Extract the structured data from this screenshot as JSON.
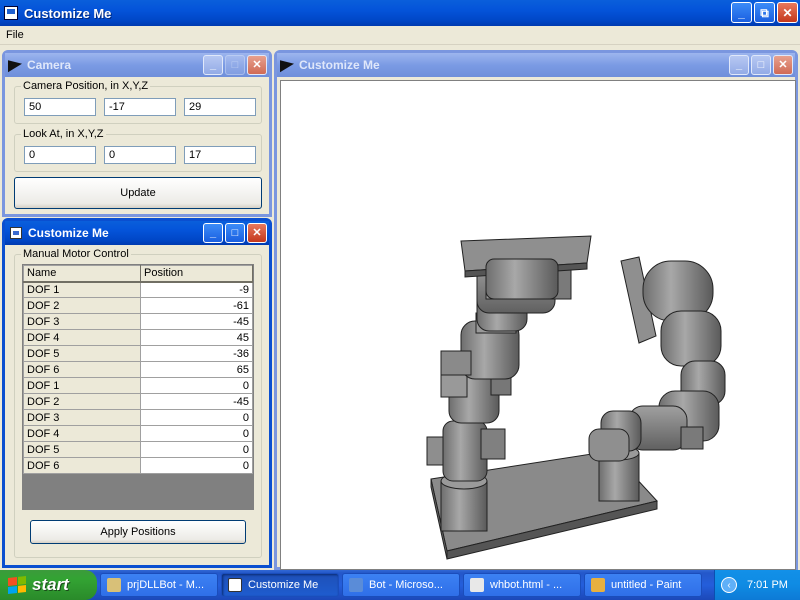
{
  "app": {
    "title": "Customize Me",
    "icon": "app-window-icon"
  },
  "window_buttons": {
    "minimize": "_",
    "maximize": "⧉",
    "close": "✕"
  },
  "menu": {
    "items": [
      "File"
    ]
  },
  "camera_window": {
    "title": "Camera",
    "position_group": {
      "legend": "Camera Position, in X,Y,Z",
      "x": "50",
      "y": "-17",
      "z": "29"
    },
    "look_group": {
      "legend": "Look At, in X,Y,Z",
      "x": "0",
      "y": "0",
      "z": "17"
    },
    "update_label": "Update"
  },
  "motor_window": {
    "title": "Customize Me",
    "group_legend": "Manual Motor Control",
    "columns": [
      "Name",
      "Position"
    ],
    "rows": [
      {
        "name": "DOF 1",
        "position": "-9"
      },
      {
        "name": "DOF 2",
        "position": "-61"
      },
      {
        "name": "DOF 3",
        "position": "-45"
      },
      {
        "name": "DOF 4",
        "position": "45"
      },
      {
        "name": "DOF 5",
        "position": "-36"
      },
      {
        "name": "DOF 6",
        "position": "65"
      },
      {
        "name": "DOF 1",
        "position": "0"
      },
      {
        "name": "DOF 2",
        "position": "-45"
      },
      {
        "name": "DOF 3",
        "position": "0"
      },
      {
        "name": "DOF 4",
        "position": "0"
      },
      {
        "name": "DOF 5",
        "position": "0"
      },
      {
        "name": "DOF 6",
        "position": "0"
      }
    ],
    "apply_label": "Apply Positions"
  },
  "viewport_window": {
    "title": "Customize Me"
  },
  "taskbar": {
    "start_label": "start",
    "tasks": [
      {
        "label": "prjDLLBot - M...",
        "icon": "vb-project-icon",
        "active": false
      },
      {
        "label": "Customize Me",
        "icon": "app-window-icon",
        "active": true
      },
      {
        "label": "Bot - Microso...",
        "icon": "office-doc-icon",
        "active": false
      },
      {
        "label": "whbot.html - ...",
        "icon": "html-file-icon",
        "active": false
      },
      {
        "label": "untitled - Paint",
        "icon": "paint-icon",
        "active": false
      }
    ],
    "clock": "7:01 PM"
  },
  "colors": {
    "title_active": "#0453d9",
    "title_inactive": "#7b9be4",
    "face": "#ece9d8",
    "robot_gray": "#8c8c8c"
  }
}
